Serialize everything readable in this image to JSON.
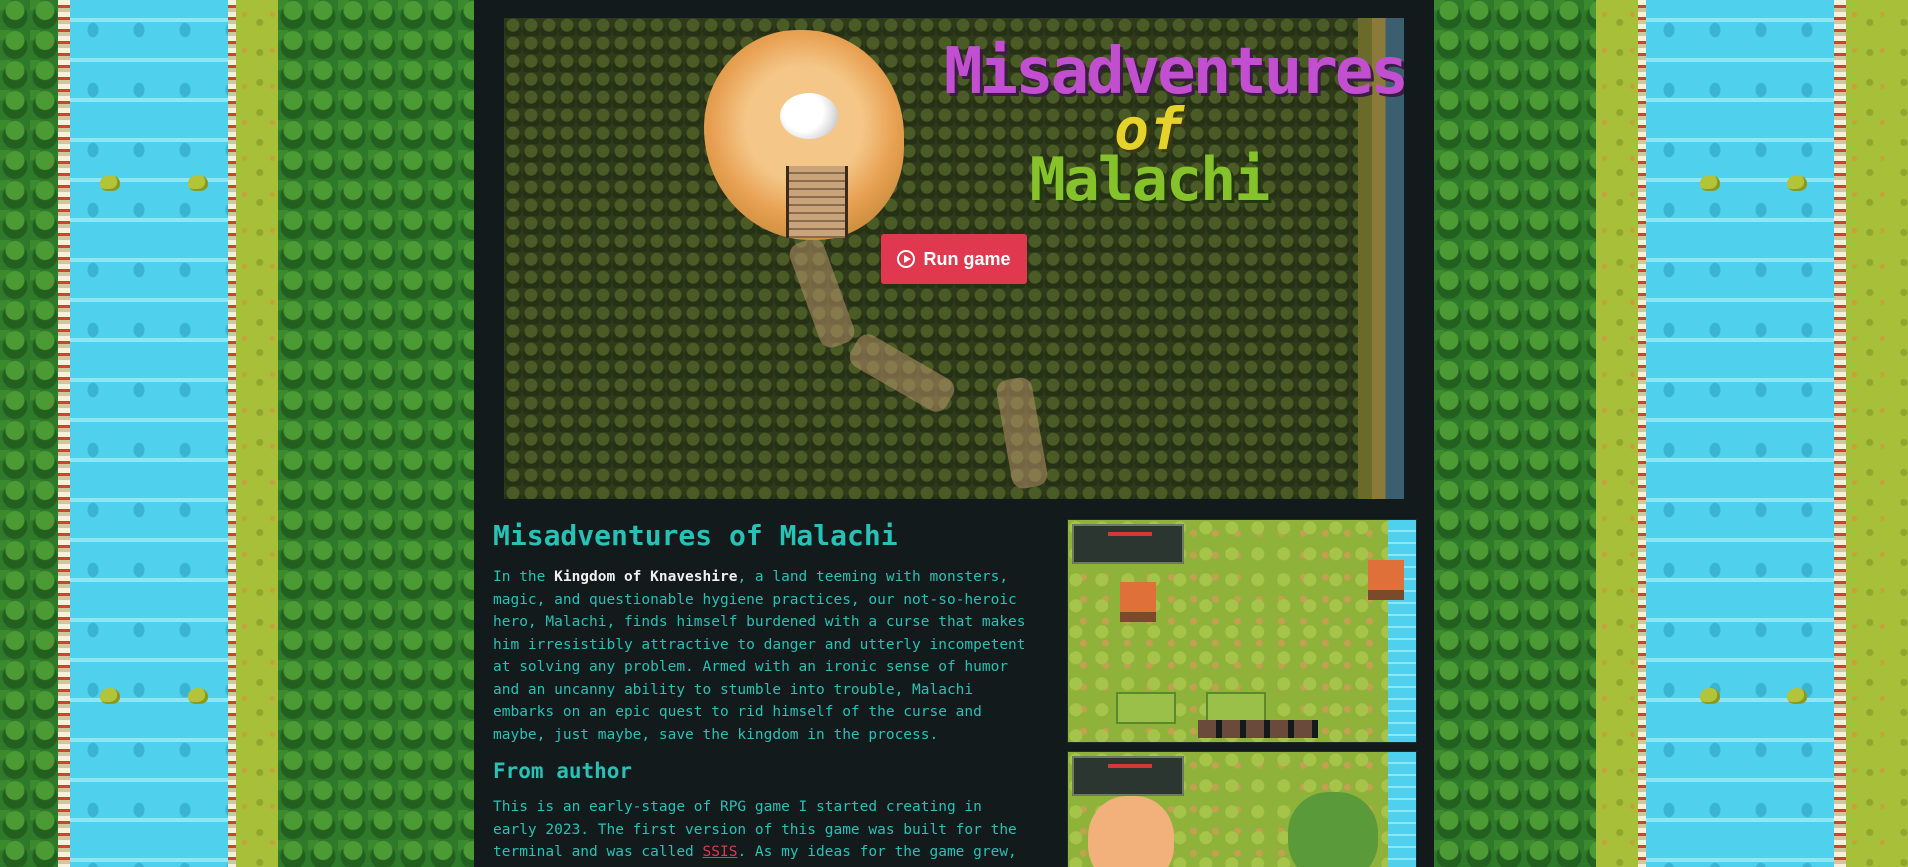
{
  "game": {
    "logo_line1": "Misadventures",
    "logo_line2": "of",
    "logo_line3": "Malachi",
    "run_label": "Run game"
  },
  "description": {
    "title": "Misadventures of Malachi",
    "para1_before": "In the ",
    "para1_bold": "Kingdom of Knaveshire",
    "para1_after": ", a land teeming with monsters, magic, and questionable hygiene practices, our not-so-heroic hero, Malachi, finds himself burdened with a curse that makes him irresistibly attractive to danger and utterly incompetent at solving any problem. Armed with an ironic sense of humor and an uncanny ability to stumble into trouble, Malachi embarks on an epic quest to rid himself of the curse and maybe, just maybe, save the kingdom in the process.",
    "author_heading": "From author",
    "para2_before": "This is an early-stage of RPG game I started creating in early 2023. The first version of this game was built for the terminal and was called ",
    "para2_link": "SSIS",
    "para2_after": ". As my ideas for the game grew, I"
  },
  "colors": {
    "accent": "#e0384e",
    "text_teal": "#27c1b6",
    "panel_bg": "#131a1c"
  },
  "icons": {
    "run": "play-circle-icon"
  }
}
